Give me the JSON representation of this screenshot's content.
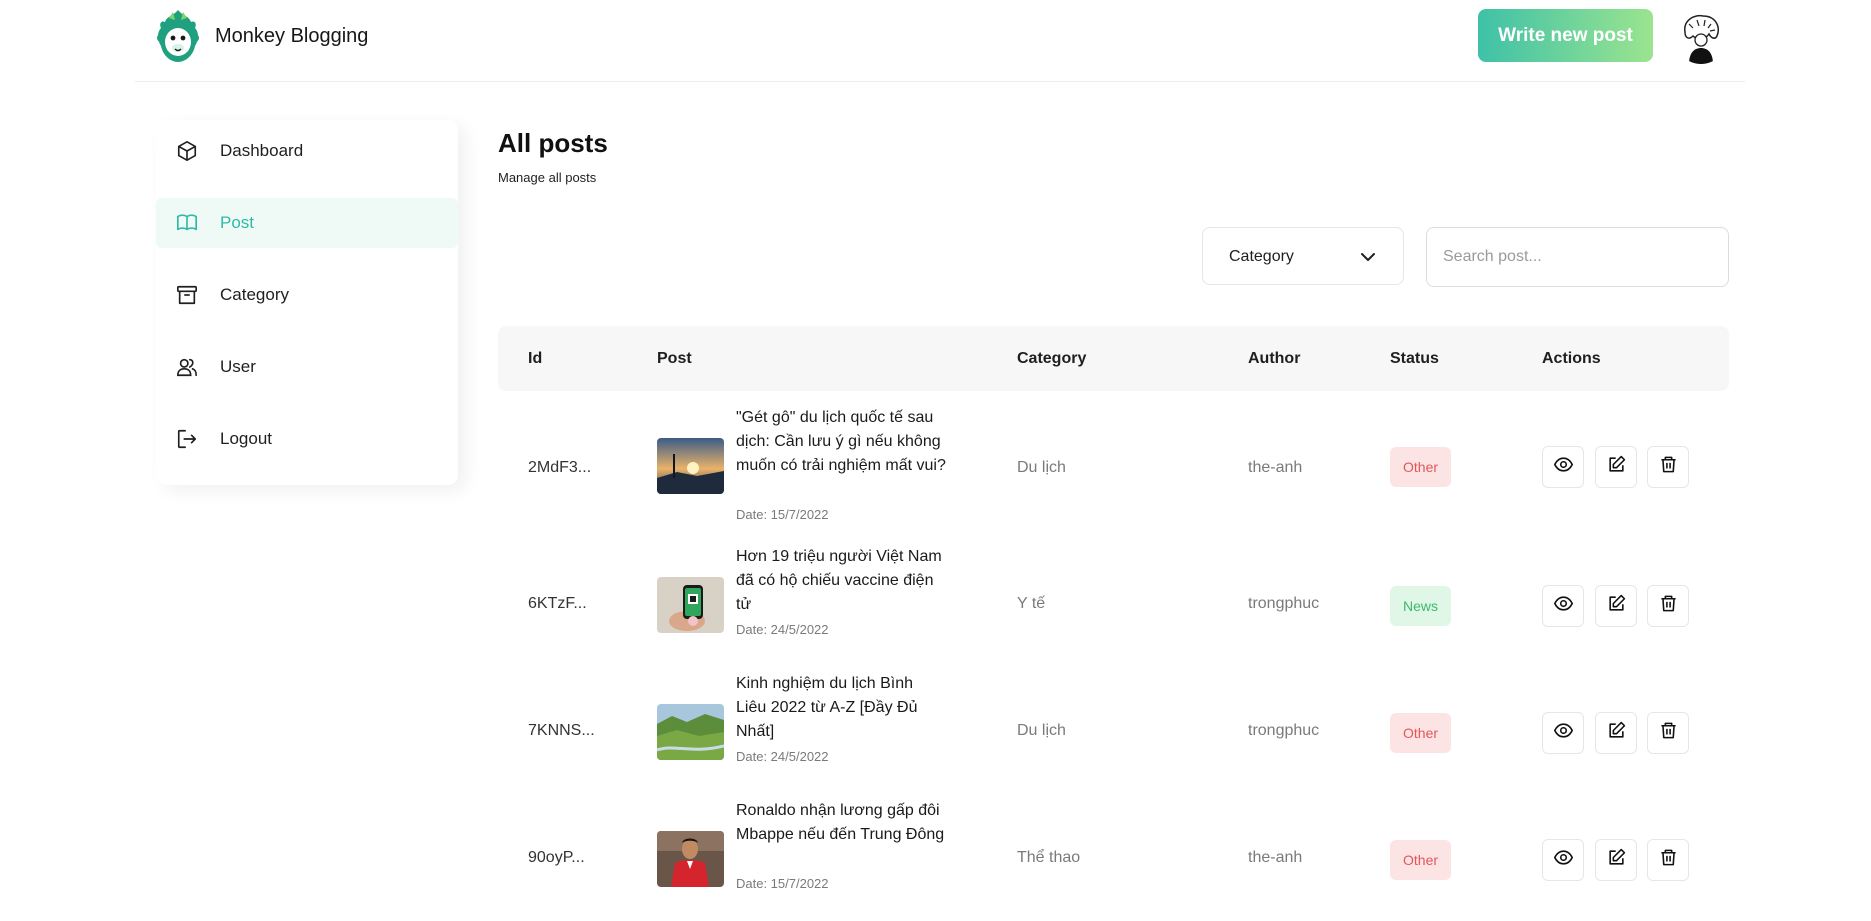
{
  "header": {
    "brand": "Monkey Blogging",
    "write_button": "Write new post",
    "logo_icon": "monkey-logo-icon",
    "avatar_icon": "user-avatar"
  },
  "sidebar": {
    "items": [
      {
        "label": "Dashboard",
        "icon": "cube-icon",
        "active": false
      },
      {
        "label": "Post",
        "icon": "book-icon",
        "active": true
      },
      {
        "label": "Category",
        "icon": "archive-icon",
        "active": false
      },
      {
        "label": "User",
        "icon": "users-icon",
        "active": false
      },
      {
        "label": "Logout",
        "icon": "logout-icon",
        "active": false
      }
    ],
    "active_color": "#2ebaa5"
  },
  "main": {
    "title": "All posts",
    "subtitle": "Manage all posts",
    "category_filter": "Category",
    "search_placeholder": "Search post...",
    "columns": [
      "Id",
      "Post",
      "Category",
      "Author",
      "Status",
      "Actions"
    ],
    "rows": [
      {
        "id": "2MdF3...",
        "title": "\"Gét gô\" du lịch quốc tế sau dịch: Cần lưu ý gì nếu không muốn có trải nghiệm mất vui?",
        "date": "Date: 15/7/2022",
        "category": "Du lịch",
        "author": "the-anh",
        "status": "Other",
        "status_type": "other"
      },
      {
        "id": "6KTzF...",
        "title": "Hơn 19 triệu người Việt Nam đã có hộ chiếu vaccine điện tử",
        "date": "Date: 24/5/2022",
        "category": "Y tế",
        "author": "trongphuc",
        "status": "News",
        "status_type": "news"
      },
      {
        "id": "7KNNS...",
        "title": "Kinh nghiệm du lịch Bình Liêu 2022 từ A-Z [Đầy Đủ Nhất]",
        "date": "Date: 24/5/2022",
        "category": "Du lịch",
        "author": "trongphuc",
        "status": "Other",
        "status_type": "other"
      },
      {
        "id": "90oyP...",
        "title": "Ronaldo nhận lương gấp đôi Mbappe nếu đến Trung Đông",
        "date": "Date: 15/7/2022",
        "category": "Thể thao",
        "author": "the-anh",
        "status": "Other",
        "status_type": "other"
      }
    ],
    "actions": [
      "eye-icon",
      "edit-icon",
      "trash-icon"
    ]
  }
}
